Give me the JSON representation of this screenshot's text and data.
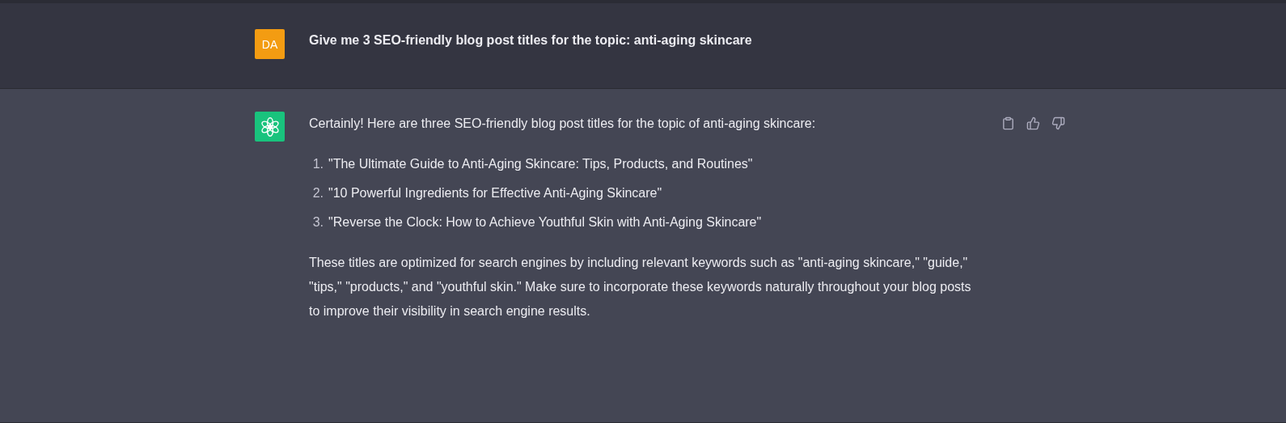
{
  "messages": [
    {
      "kind": "user",
      "avatar": "DA",
      "text": "Give me 3 SEO-friendly blog post titles for the topic: anti-aging skincare"
    },
    {
      "kind": "assistant",
      "intro": "Certainly! Here are three SEO-friendly blog post titles for the topic of anti-aging skincare:",
      "list": [
        {
          "number": "1.",
          "text": "\"The Ultimate Guide to Anti-Aging Skincare: Tips, Products, and Routines\""
        },
        {
          "number": "2.",
          "text": "\"10 Powerful Ingredients for Effective Anti-Aging Skincare\""
        },
        {
          "number": "3.",
          "text": "\"Reverse the Clock: How to Achieve Youthful Skin with Anti-Aging Skincare\""
        }
      ],
      "outro": "These titles are optimized for search engines by including relevant keywords such as \"anti-aging skincare,\" \"guide,\" \"tips,\" \"products,\" and \"youthful skin.\" Make sure to incorporate these keywords naturally throughout your blog posts to improve their visibility in search engine results."
    }
  ]
}
